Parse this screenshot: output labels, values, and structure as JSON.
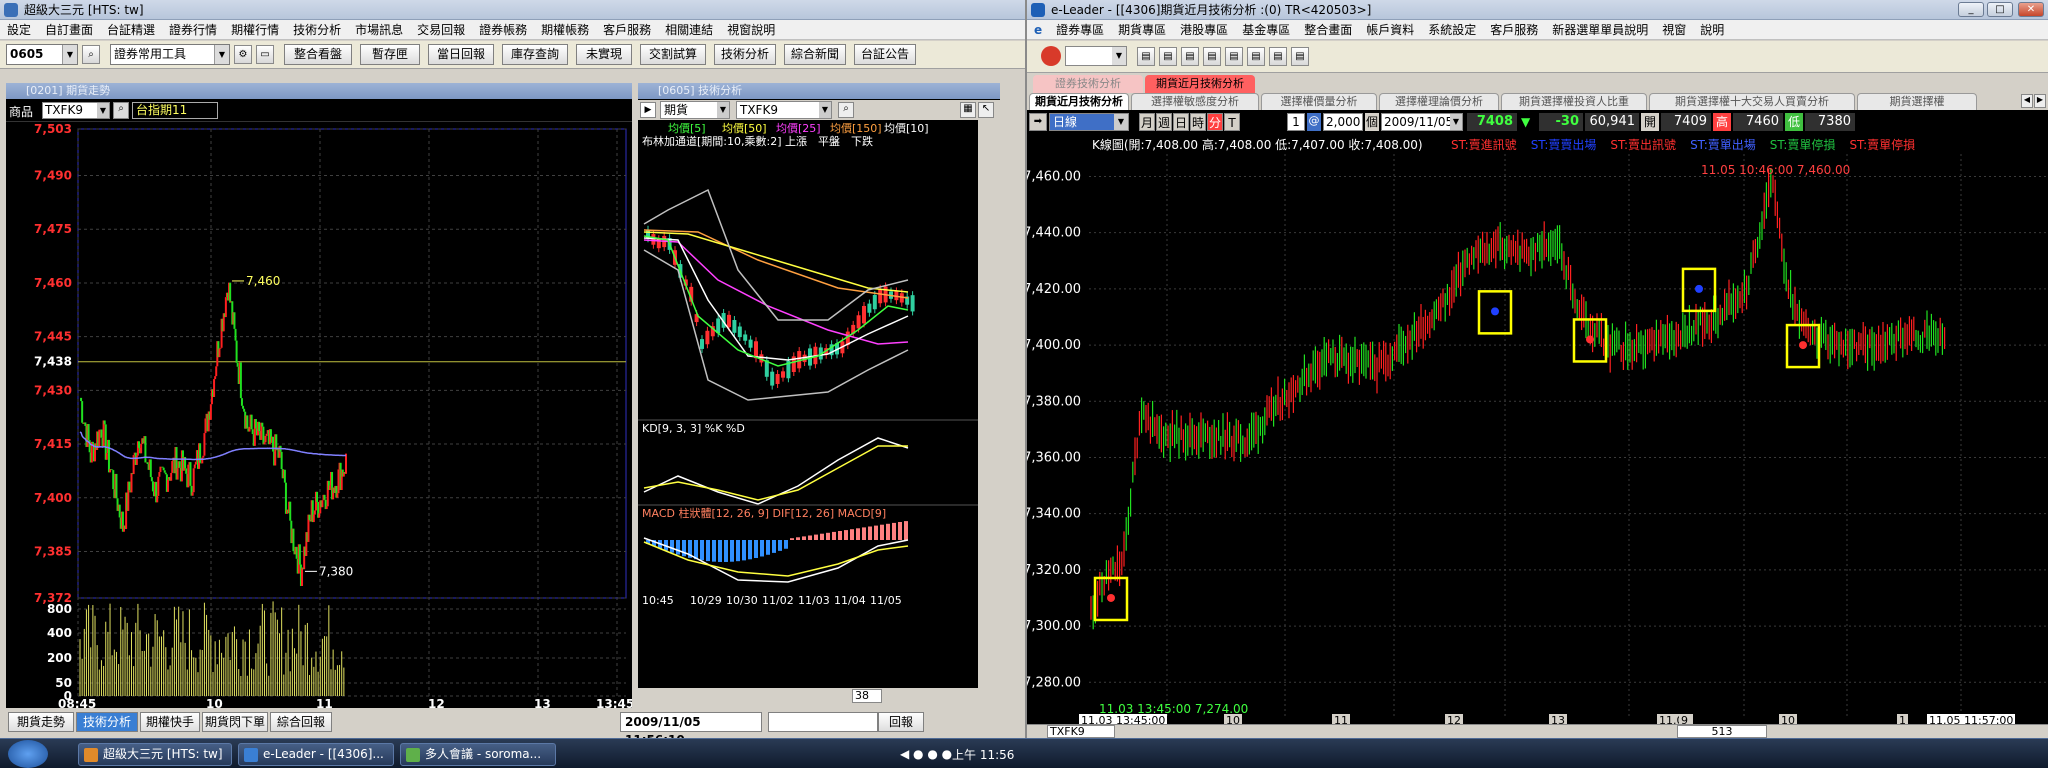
{
  "left": {
    "title": "超級大三元 [HTS: tw]",
    "menu": [
      "設定",
      "自訂畫面",
      "台証精選",
      "證券行情",
      "期權行情",
      "技術分析",
      "市場訊息",
      "交易回報",
      "證券帳務",
      "期權帳務",
      "客戶服務",
      "相關連結",
      "視窗說明"
    ],
    "toolbar": {
      "stock_code": "0605",
      "tool_combo": "證券常用工具",
      "buttons": [
        "整合看盤",
        "暫存匣",
        "當日回報",
        "庫存查詢",
        "未實現",
        "交割試算",
        "技術分析",
        "綜合新聞",
        "台証公告"
      ]
    },
    "intraday": {
      "title": "[0201] 期貨走勢",
      "product_label": "商品",
      "product_code": "TXFK9",
      "product_name": "台指期11",
      "y_labels": [
        "7,503",
        "7,490",
        "7,475",
        "7,460",
        "7,445",
        "7,438",
        "7,430",
        "7,415",
        "7,400",
        "7,385",
        "7,372"
      ],
      "vol_labels": [
        "800",
        "400",
        "200",
        "50",
        "0"
      ],
      "x_labels": [
        "08:45",
        "10",
        "11",
        "12",
        "13",
        "13:45"
      ],
      "high_note": "7,460",
      "low_note": "7,380",
      "colors": {
        "up": "#ff2020",
        "down": "#20e020",
        "avg": "#8080ff",
        "vol": "#e0e060"
      }
    },
    "tech": {
      "title": "[0605] 技術分析",
      "type_combo": "期貨",
      "code_combo": "TXFK9",
      "ma_legend": [
        "均價[5]",
        "均價[50]",
        "均價[25]",
        "均價[150]",
        "均價[10]"
      ],
      "boll_legend": "布林加通道[期間:10,乘數:2] 上漲　平盤　下跌",
      "kd_legend": "KD[9, 3, 3] %K %D",
      "macd_legend": "MACD 柱狀體[12, 26, 9] DIF[12, 26] MACD[9]",
      "x_labels": [
        "10:45",
        "10/29",
        "10/30",
        "11/02",
        "11/03",
        "11/04",
        "11/05"
      ],
      "scroll_value": "38"
    },
    "bottom_tabs": [
      "期貨走勢",
      "技術分析",
      "期權快手",
      "期貨閃下單",
      "綜合回報"
    ],
    "datetime": "2009/11/05 11:56:10",
    "return_btn": "回報"
  },
  "right": {
    "title": "e-Leader - [[4306]期貨近月技術分析 :(0) TR<420503>]",
    "menu": [
      "證券專區",
      "期貨專區",
      "港股專區",
      "基金專區",
      "整合畫面",
      "帳戶資料",
      "系統設定",
      "客戶服務",
      "新器選單單員說明",
      "視窗",
      "說明"
    ],
    "sub_tabs": [
      "證券技術分析",
      "期貨近月技術分析"
    ],
    "func_tabs": [
      "期貨近月技術分析",
      "選擇權敏感度分析",
      "選擇權價量分析",
      "選擇權理論價分析",
      "期貨選擇權投資人比重",
      "期貨選擇權十大交易人買賣分析",
      "期貨選擇權"
    ],
    "controls": {
      "period_combo": "日線",
      "periods": [
        "月",
        "週",
        "日",
        "時",
        "分",
        "T"
      ],
      "n_value": "1",
      "count_value": "2,000",
      "count_unit": "個",
      "date": "2009/11/05",
      "quote": {
        "last": "7408",
        "change": "-30",
        "volume": "60,941",
        "open_label": "開",
        "open": "7409",
        "high_label": "高",
        "high": "7460",
        "low_label": "低",
        "low": "7380"
      }
    },
    "chart_info": {
      "ohlc": "K線圖(開:7,408.00 高:7,408.00 低:7,407.00 收:7,408.00)",
      "signals": [
        {
          "text": "ST:賣進訊號",
          "color": "#ff3030"
        },
        {
          "text": "ST:賣賣出場",
          "color": "#2040ff"
        },
        {
          "text": "ST:賣出訊號",
          "color": "#ff3030"
        },
        {
          "text": "ST:賣單出場",
          "color": "#4060ff"
        },
        {
          "text": "ST:賣單停損",
          "color": "#20c040"
        },
        {
          "text": "ST:賣單停損",
          "color": "#ff3030"
        }
      ],
      "high_note": "11.05 10:46:00  7,460.00",
      "low_note": "11.03 13:45:00  7,274.00"
    },
    "y_labels": [
      "7,460.00",
      "7,440.00",
      "7,420.00",
      "7,400.00",
      "7,380.00",
      "7,360.00",
      "7,340.00",
      "7,320.00",
      "7,300.00",
      "7,280.00"
    ],
    "x_labels": [
      "11.03 13:45:00",
      "10",
      "11",
      "12",
      "13",
      "11.05",
      "9",
      "10",
      "1",
      "11.05 11:57:00"
    ],
    "bottom": {
      "code": "TXFK9",
      "scroll_value": "513"
    }
  },
  "taskbar": {
    "items": [
      "超級大三元 [HTS: tw]",
      "e-Leader - [[4306]...",
      "多人會議 - soroma..."
    ],
    "clock": "上午 11:56"
  }
}
